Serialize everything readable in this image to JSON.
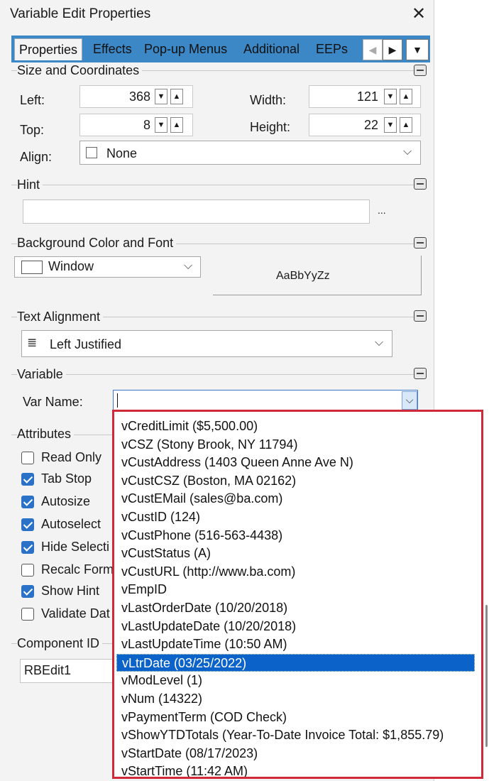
{
  "window": {
    "title": "Variable Edit Properties"
  },
  "tabs": [
    "Properties",
    "Effects",
    "Pop-up Menus",
    "Additional",
    "EEPs"
  ],
  "size": {
    "heading": "Size and Coordinates",
    "left_label": "Left:",
    "left_value": "368",
    "top_label": "Top:",
    "top_value": "8",
    "width_label": "Width:",
    "width_value": "121",
    "height_label": "Height:",
    "height_value": "22",
    "align_label": "Align:",
    "align_value": "None"
  },
  "hint": {
    "heading": "Hint",
    "value": "",
    "ellipsis": "..."
  },
  "bg": {
    "heading": "Background Color and Font",
    "color_value": "Window",
    "font_preview": "AaBbYyZz"
  },
  "text_alignment": {
    "heading": "Text Alignment",
    "value": "Left Justified"
  },
  "variable": {
    "heading": "Variable",
    "var_name_label": "Var Name:",
    "var_name_value": ""
  },
  "attributes": {
    "heading": "Attributes",
    "items": [
      {
        "label": "Read Only",
        "checked": false
      },
      {
        "label": "Tab Stop",
        "checked": true
      },
      {
        "label": "Autosize",
        "checked": true
      },
      {
        "label": "Autoselect",
        "checked": true
      },
      {
        "label": "Hide Selecti",
        "checked": true
      },
      {
        "label": "Recalc Form",
        "checked": false
      },
      {
        "label": "Show Hint",
        "checked": true
      },
      {
        "label": "Validate Dat",
        "checked": false
      }
    ]
  },
  "component": {
    "heading": "Component ID",
    "value": "RBEdit1"
  },
  "dropdown": {
    "selected_index": 13,
    "items": [
      "vCreditLimit  ($5,500.00)",
      "vCSZ  (Stony Brook, NY 11794)",
      "vCustAddress  (1403 Queen Anne Ave N)",
      "vCustCSZ  (Boston, MA 02162)",
      "vCustEMail  (sales@ba.com)",
      "vCustID  (124)",
      "vCustPhone  (516-563-4438)",
      "vCustStatus  (A)",
      "vCustURL  (http://www.ba.com)",
      "vEmpID",
      "vLastOrderDate  (10/20/2018)",
      "vLastUpdateDate  (10/20/2018)",
      "vLastUpdateTime  (10:50 AM)",
      "vLtrDate  (03/25/2022)",
      "vModLevel  (1)",
      "vNum  (14322)",
      "vPaymentTerm  (COD Check)",
      "vShowYTDTotals  (Year-To-Date Invoice Total:  $1,855.79)",
      "vStartDate  (08/17/2023)",
      "vStartTime  (11:42 AM)"
    ]
  },
  "colors": {
    "tab_strip": "#3c87c6",
    "selection": "#0b63c9",
    "checkbox": "#2a72c8",
    "highlight_border": "#d02a3a"
  }
}
